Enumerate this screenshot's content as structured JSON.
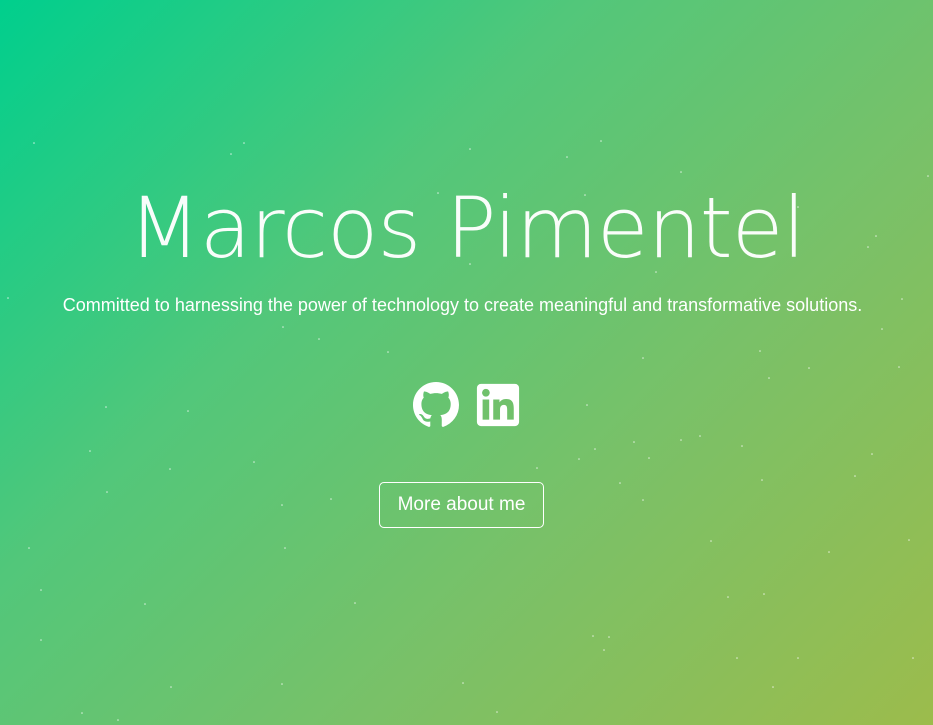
{
  "hero": {
    "name": "Marcos Pimentel",
    "tagline": "Committed to harnessing the power of technology to create meaningful and transformative solutions.",
    "socials": [
      {
        "icon": "github-icon",
        "label": "GitHub"
      },
      {
        "icon": "linkedin-icon",
        "label": "LinkedIn"
      }
    ],
    "cta_label": "More about me"
  },
  "colors": {
    "gradient_start": "#00cf8d",
    "gradient_end": "#9cbc4c",
    "text": "#ffffff"
  }
}
